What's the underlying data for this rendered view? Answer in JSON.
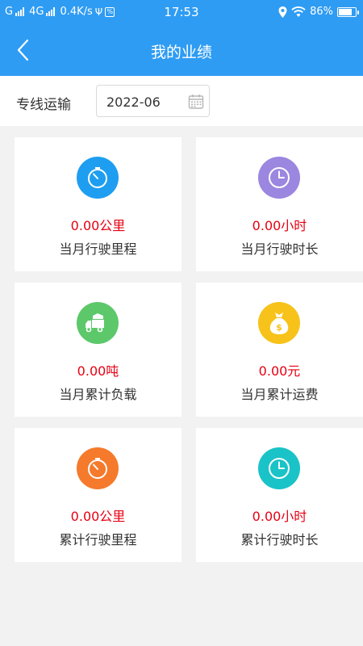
{
  "status_bar": {
    "left": "Gᴵᴵ 4G",
    "network_prefix": "G",
    "network_type": "4G",
    "speed": "0.4K/s",
    "usb": "Ψ",
    "hd_badge": "%",
    "time": "17:53",
    "battery": "86%",
    "battery_level": 0.86
  },
  "header": {
    "title": "我的业绩"
  },
  "filter": {
    "label": "专线运输",
    "date_value": "2022-06"
  },
  "cards": [
    {
      "value": "0.00公里",
      "label": "当月行驶里程",
      "icon": "speedometer-icon",
      "color": "#1e9ef0"
    },
    {
      "value": "0.00小时",
      "label": "当月行驶时长",
      "icon": "clock-icon",
      "color": "#9b86e0"
    },
    {
      "value": "0.00吨",
      "label": "当月累计负载",
      "icon": "truck-icon",
      "color": "#5cc86a"
    },
    {
      "value": "0.00元",
      "label": "当月累计运费",
      "icon": "money-bag-icon",
      "color": "#f7c21a"
    },
    {
      "value": "0.00公里",
      "label": "累计行驶里程",
      "icon": "speedometer-icon",
      "color": "#f57a2c"
    },
    {
      "value": "0.00小时",
      "label": "累计行驶时长",
      "icon": "clock-icon",
      "color": "#19c3c7"
    }
  ]
}
